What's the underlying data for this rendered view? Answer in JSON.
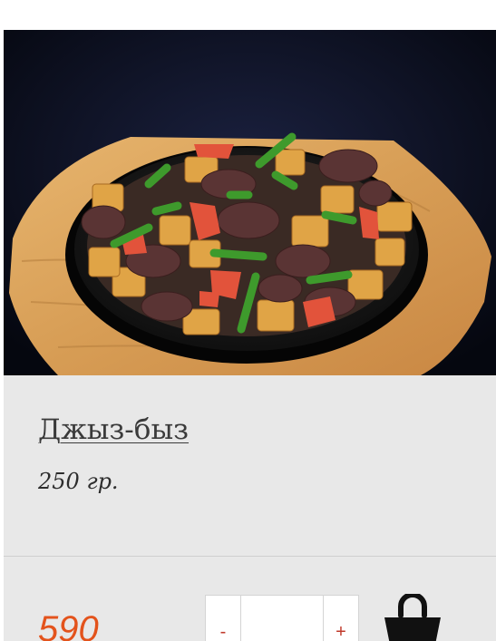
{
  "product": {
    "name": "Джыз-быз",
    "weight": "250 гр.",
    "price": "590",
    "image_icon": "food-photo"
  },
  "quantity": {
    "decrement_label": "-",
    "increment_label": "+",
    "value": ""
  },
  "cart": {
    "icon": "shopping-basket-icon"
  },
  "colors": {
    "card_background": "#e8e8e8",
    "price": "#e3531c",
    "qty_button_text": "#c0392b",
    "photo_background": "#0a0d1e"
  }
}
